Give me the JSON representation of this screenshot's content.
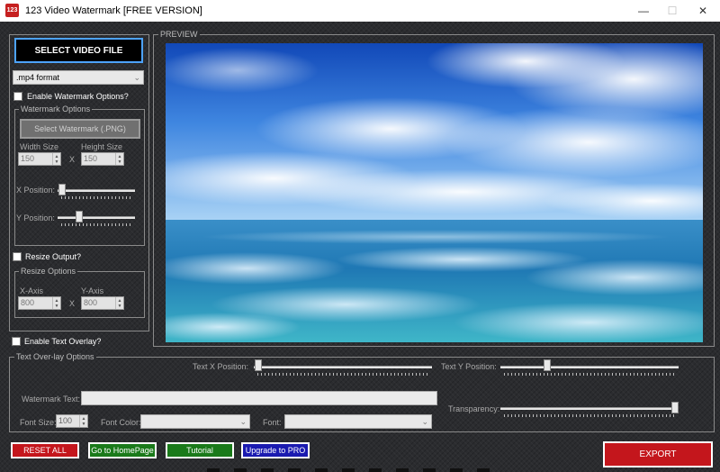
{
  "window": {
    "title": "123 Video Watermark [FREE VERSION]",
    "app_icon_text": "123",
    "minimize_glyph": "—",
    "maximize_glyph": "☐",
    "close_glyph": "✕"
  },
  "left": {
    "select_video_label": "SELECT VIDEO FILE",
    "format_value": ".mp4 format",
    "enable_watermark_label": "Enable Watermark Options?",
    "watermark_group": {
      "legend": "Watermark Options",
      "select_watermark_label": "Select Watermark (.PNG)",
      "width_label": "Width Size",
      "height_label": "Height Size",
      "width_value": "150",
      "height_value": "150",
      "x_sep": "X",
      "x_position_label": "X Position:",
      "y_position_label": "Y Position:"
    },
    "resize_output_label": "Resize Output?",
    "resize_group": {
      "legend": "Resize Options",
      "x_axis_label": "X-Axis",
      "y_axis_label": "Y-Axis",
      "x_value": "800",
      "y_value": "800",
      "x_sep": "X"
    },
    "enable_text_overlay_label": "Enable Text Overlay?"
  },
  "preview": {
    "legend": "PREVIEW"
  },
  "text_overlay": {
    "legend": "Text Over-lay Options",
    "text_x_position_label": "Text X Position:",
    "text_y_position_label": "Text Y Position:",
    "watermark_text_label": "Watermark Text:",
    "transparency_label": "Transparency:",
    "font_size_label": "Font Size:",
    "font_size_value": "100",
    "font_color_label": "Font Color:",
    "font_label": "Font:"
  },
  "buttons": {
    "reset_all": "RESET ALL",
    "homepage": "Go to HomePage",
    "tutorial": "Tutorial",
    "upgrade": "Upgrade to PRO",
    "export": "EXPORT"
  },
  "colors": {
    "reset": "#c4161c",
    "homepage": "#1a7a1a",
    "tutorial": "#1a7a1a",
    "upgrade": "#1a1ab0",
    "export": "#c4161c"
  }
}
